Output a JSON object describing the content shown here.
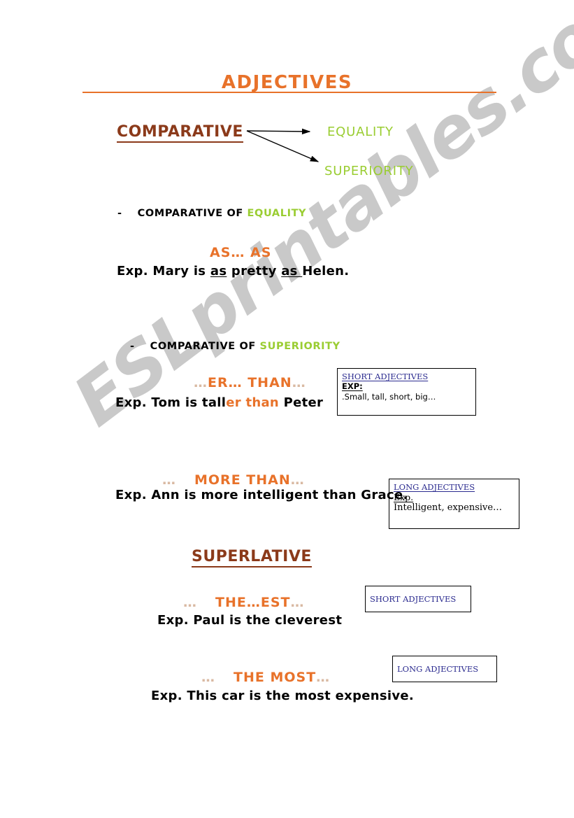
{
  "document": {
    "title": "ADJECTIVES",
    "watermark": "ESLprintables.com"
  },
  "colors": {
    "orange": "#e8722a",
    "dark_red": "#8b3a1a",
    "green": "#9acd32",
    "box_blue": "#2b2b8f",
    "black": "#000000",
    "watermark_gray": "#c9c9c9"
  },
  "comparative": {
    "heading": "COMPARATIVE",
    "branches": [
      {
        "label": "EQUALITY"
      },
      {
        "label": "SUPERIORITY"
      }
    ],
    "equality": {
      "bullet_dash": "-",
      "bullet_prefix": "COMPARATIVE OF ",
      "bullet_highlight": "EQUALITY",
      "formula": "AS… AS",
      "example": {
        "lead": "Exp. Mary is ",
        "underline_1": "as",
        "mid": " pretty ",
        "underline_2": "as ",
        "tail": "Helen."
      }
    },
    "superiority": {
      "bullet_dash": "-",
      "bullet_prefix": "COMPARATIVE OF ",
      "bullet_highlight": "SUPERIORITY",
      "short_form": {
        "formula_faint_left": "…",
        "formula_main": "ER… THAN",
        "formula_faint_right": "…",
        "example": {
          "lead": "Exp. Tom is tall",
          "orange": "er than",
          "tail": " Peter"
        },
        "box": {
          "title": "SHORT ADJECTIVES",
          "exp_label": "EXP:",
          "items": ".Small, tall, short, big…"
        }
      },
      "long_form": {
        "formula_faint_left": "…",
        "formula_main": "MORE THAN",
        "formula_faint_right": "…",
        "example": "Exp. Ann is more intelligent than Grace.",
        "box": {
          "title": "LONG ADJECTIVES",
          "exp_label": "Exp.",
          "items": "Intelligent, expensive…"
        }
      }
    }
  },
  "superlative": {
    "heading": "SUPERLATIVE",
    "short_form": {
      "formula_faint_left": "…",
      "formula_main": "THE…EST",
      "formula_faint_right": "…",
      "example": "Exp. Paul is the cleverest",
      "box": {
        "title": "SHORT ADJECTIVES"
      }
    },
    "long_form": {
      "formula_faint_left": "…",
      "formula_main": "THE MOST",
      "formula_faint_right": "…",
      "example": "Exp. This car is the most expensive.",
      "box": {
        "title": "LONG ADJECTIVES"
      }
    }
  }
}
